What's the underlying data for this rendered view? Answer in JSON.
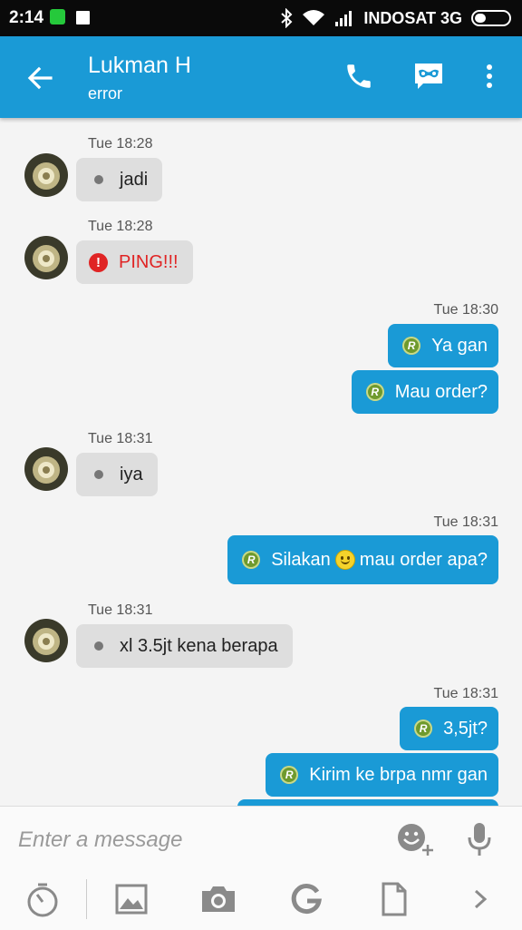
{
  "status_bar": {
    "time": "2:14",
    "carrier": "INDOSAT 3G"
  },
  "header": {
    "contact_name": "Lukman H",
    "subtitle": "error"
  },
  "messages": [
    {
      "timestamp": "Tue 18:28",
      "text": "jadi"
    },
    {
      "timestamp": "Tue 18:28",
      "text": "PING!!!"
    },
    {
      "timestamp": "Tue 18:30",
      "text": "Ya gan"
    },
    {
      "text": "Mau order?"
    },
    {
      "timestamp": "Tue 18:31",
      "text": "iya"
    },
    {
      "timestamp": "Tue 18:31",
      "text_before": "Silakan",
      "text_after": "mau order apa?"
    },
    {
      "timestamp": "Tue 18:31",
      "text": "xl 3.5jt kena berapa"
    },
    {
      "timestamp": "Tue 18:31",
      "text": "3,5jt?"
    },
    {
      "text": "Kirim ke brpa nmr gan"
    }
  ],
  "read_badge_letter": "R",
  "input": {
    "placeholder": "Enter a message"
  },
  "colors": {
    "accent": "#1a9ad6",
    "incoming_bubble": "#dedede",
    "ping_red": "#e02424",
    "status_bar": "#0a0a0a"
  }
}
